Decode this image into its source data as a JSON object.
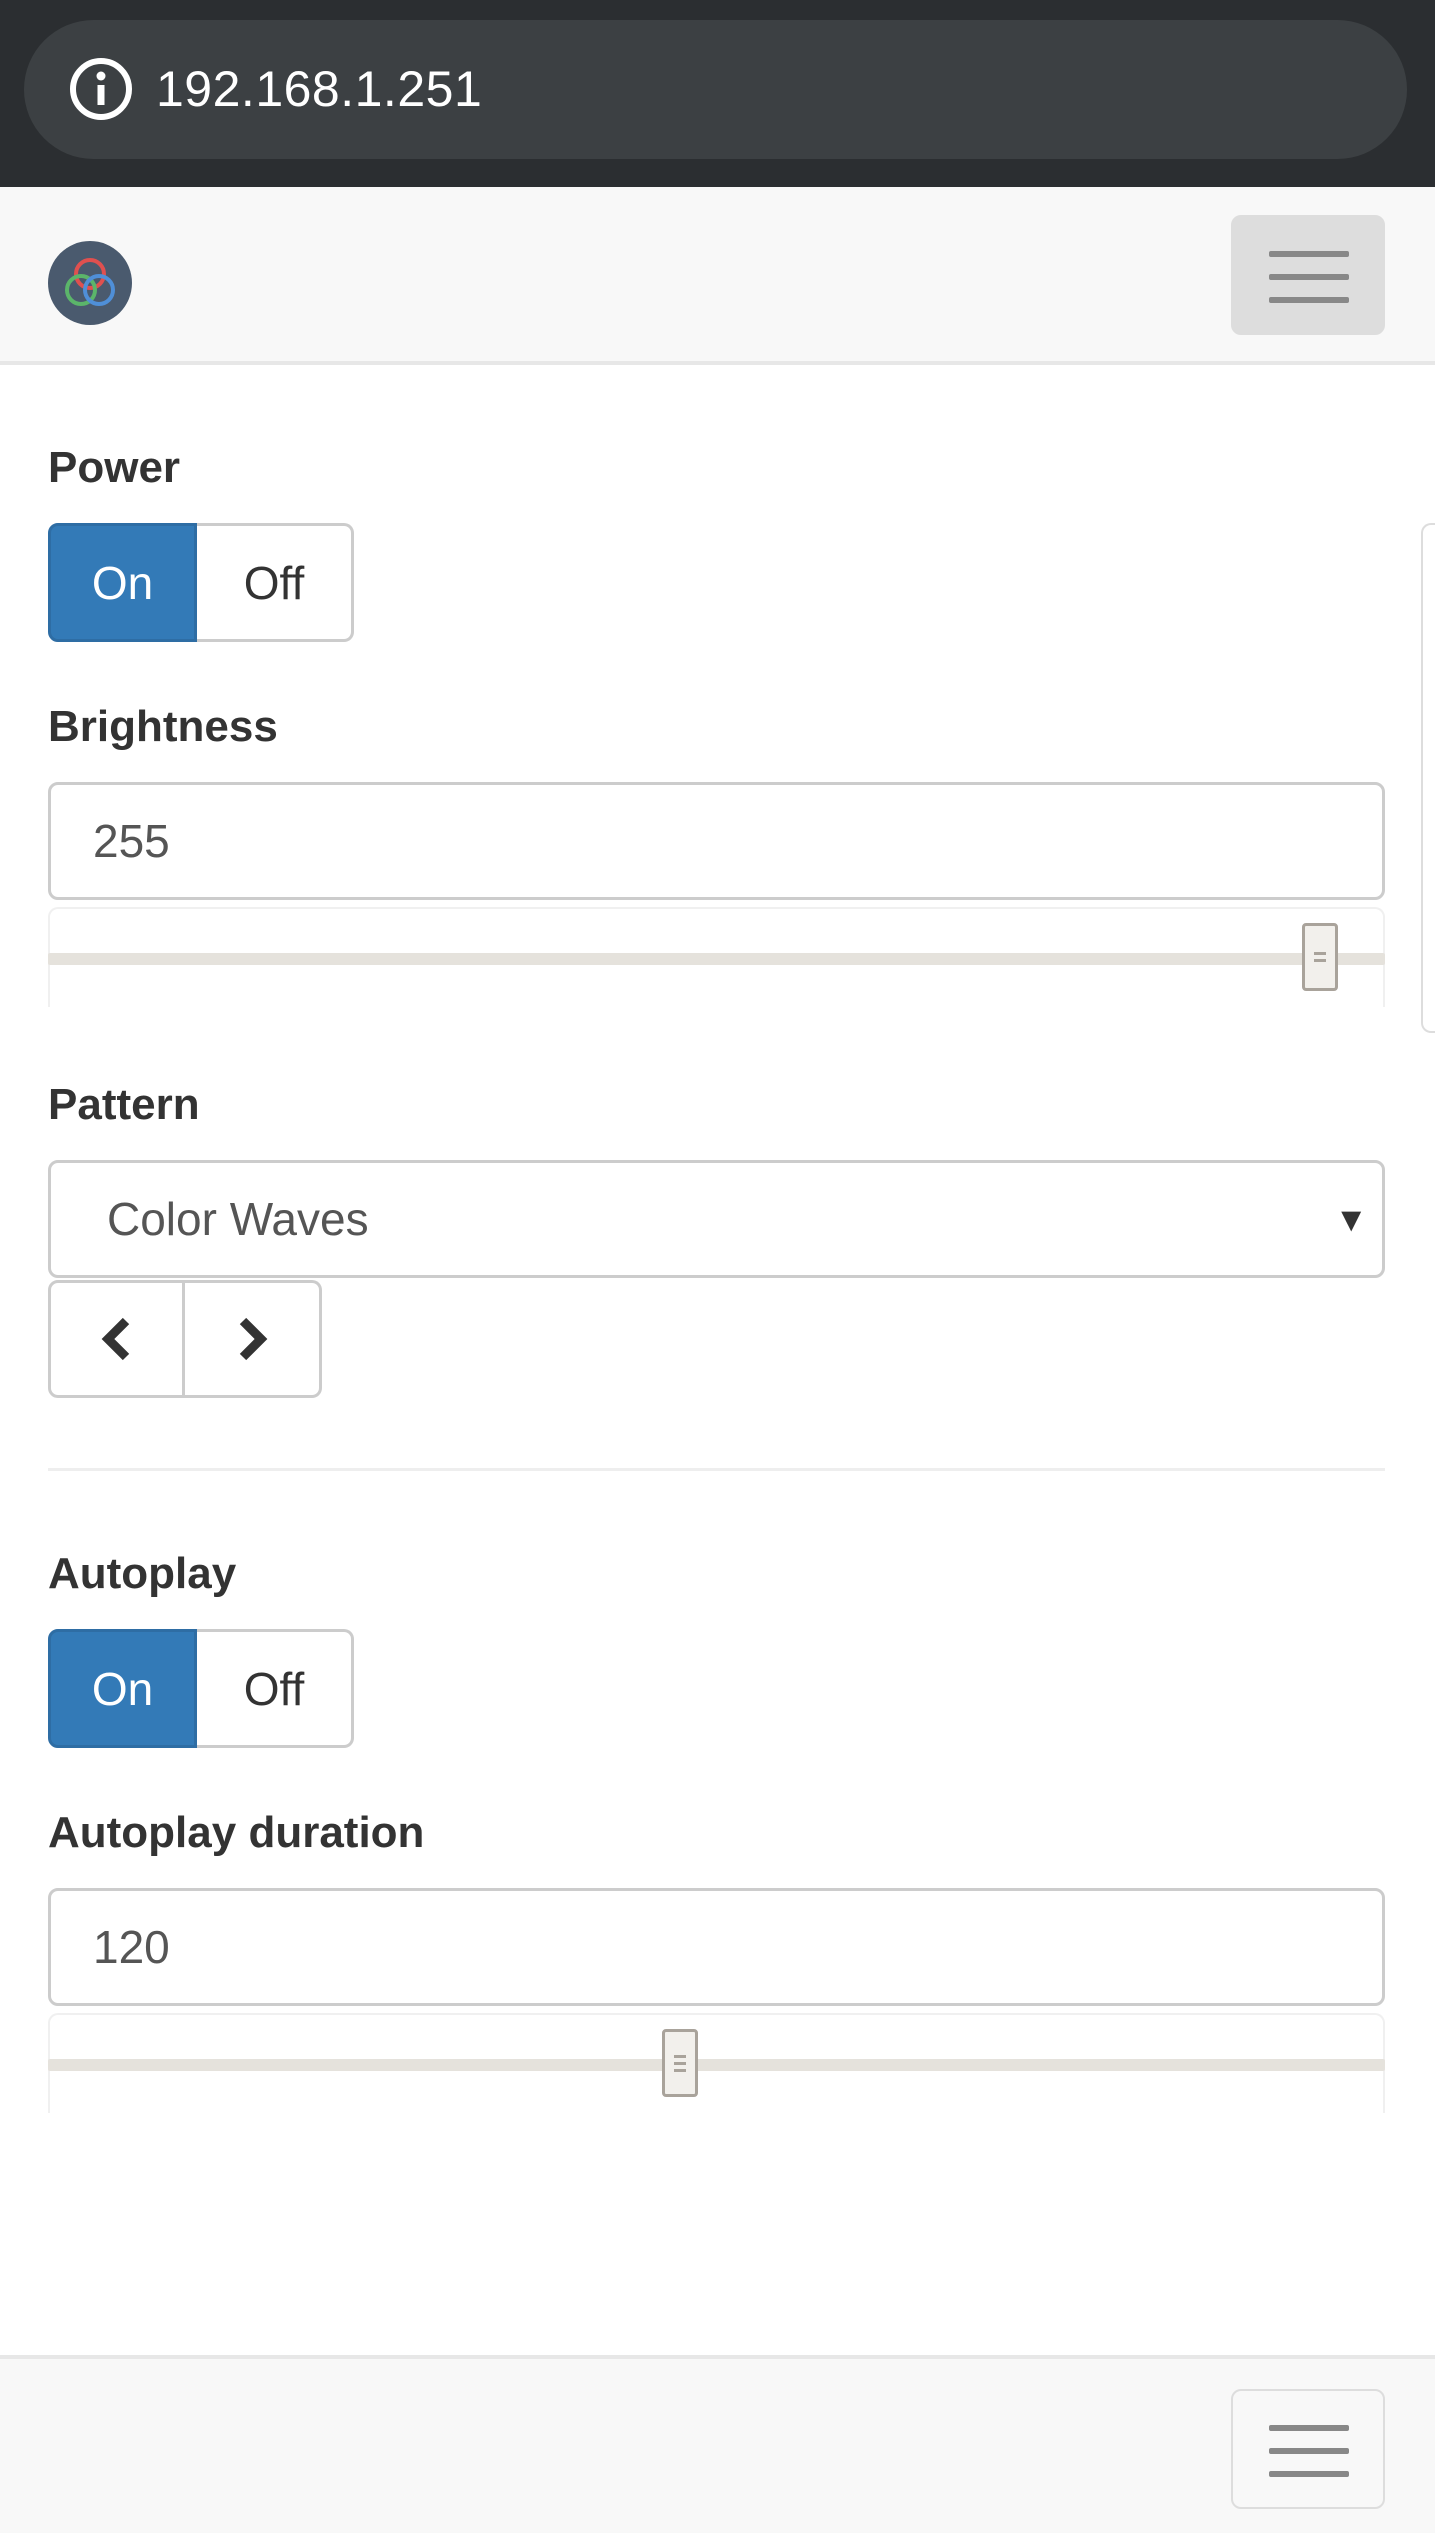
{
  "browser": {
    "url": "192.168.1.251"
  },
  "navbar": {
    "logo": "rgb-rings-logo",
    "menu_icon": "hamburger-icon"
  },
  "power": {
    "label": "Power",
    "on_label": "On",
    "off_label": "Off",
    "selected": "On"
  },
  "brightness": {
    "label": "Brightness",
    "value": "255",
    "slider_fraction": 1.0
  },
  "pattern": {
    "label": "Pattern",
    "selected": "Color Waves",
    "prev_icon": "chevron-left-icon",
    "next_icon": "chevron-right-icon"
  },
  "autoplay": {
    "label": "Autoplay",
    "on_label": "On",
    "off_label": "Off",
    "selected": "On"
  },
  "autoplay_duration": {
    "label": "Autoplay duration",
    "value": "120",
    "slider_fraction": 0.47
  },
  "colors": {
    "primary": "#337ab7",
    "browser_bar": "#2b2e31",
    "navbar_bg": "#f8f8f8"
  }
}
